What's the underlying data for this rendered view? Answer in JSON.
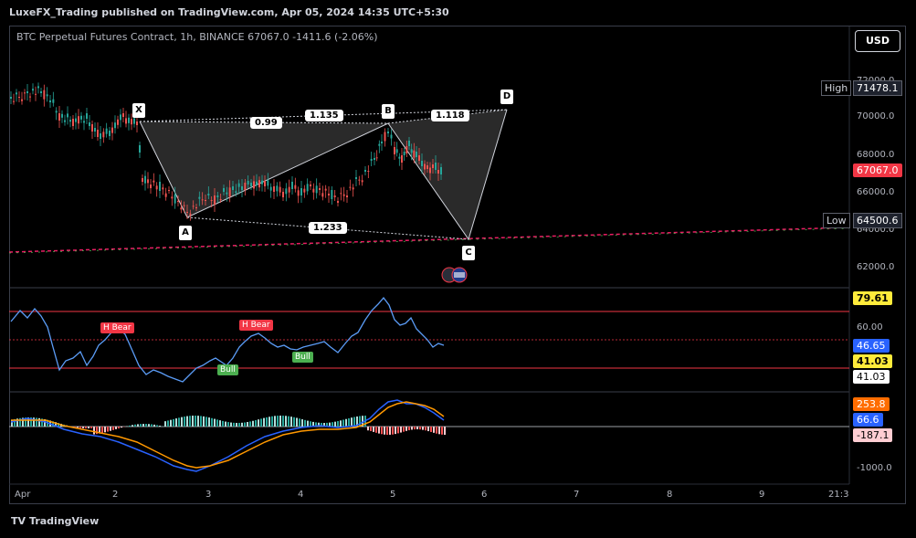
{
  "header": {
    "publisher_line": "LuxeFX_Trading published on TradingView.com, Apr 05, 2024 14:35 UTC+5:30"
  },
  "symbol": {
    "line": "BTC Perpetual Futures Contract, 1h, BINANCE  67067.0  -1411.6 (-2.06%)"
  },
  "currency_button": "USD",
  "price_axis": {
    "ticks": [
      "72000.0",
      "70000.0",
      "68000.0",
      "66000.0",
      "64000.0",
      "62000.0"
    ],
    "high_label": "High",
    "high_value": "71478.1",
    "low_label": "Low",
    "low_value": "64500.6",
    "last_price": "67067.0",
    "last_price_color": "#f23645"
  },
  "harmonic": {
    "points": [
      "X",
      "A",
      "B",
      "C",
      "D"
    ],
    "ratios": [
      "0.99",
      "1.135",
      "1.118",
      "1.233"
    ]
  },
  "rsi_panel": {
    "level_top": "79.61",
    "tick_mid": "60.00",
    "value_blue": "46.65",
    "value_yellow": "41.03",
    "value_white": "41.03",
    "signals": [
      {
        "label": "H Bear",
        "type": "bear"
      },
      {
        "label": "H Bear",
        "type": "bear"
      },
      {
        "label": "Bull",
        "type": "bull"
      },
      {
        "label": "Bull",
        "type": "bull"
      }
    ]
  },
  "macd_panel": {
    "value_orange": "253.8",
    "value_blue": "66.6",
    "value_pink": "-187.1",
    "tick_low": "-1000.0"
  },
  "time_axis": {
    "ticks": [
      "Apr",
      "2",
      "3",
      "4",
      "5",
      "6",
      "7",
      "8",
      "9",
      "21:3"
    ]
  },
  "footer": {
    "logo": "TV",
    "brand": "TradingView"
  },
  "colors": {
    "up": "#26a69a",
    "down": "#ef5350",
    "bg": "#000000",
    "accent": "#f23645"
  }
}
